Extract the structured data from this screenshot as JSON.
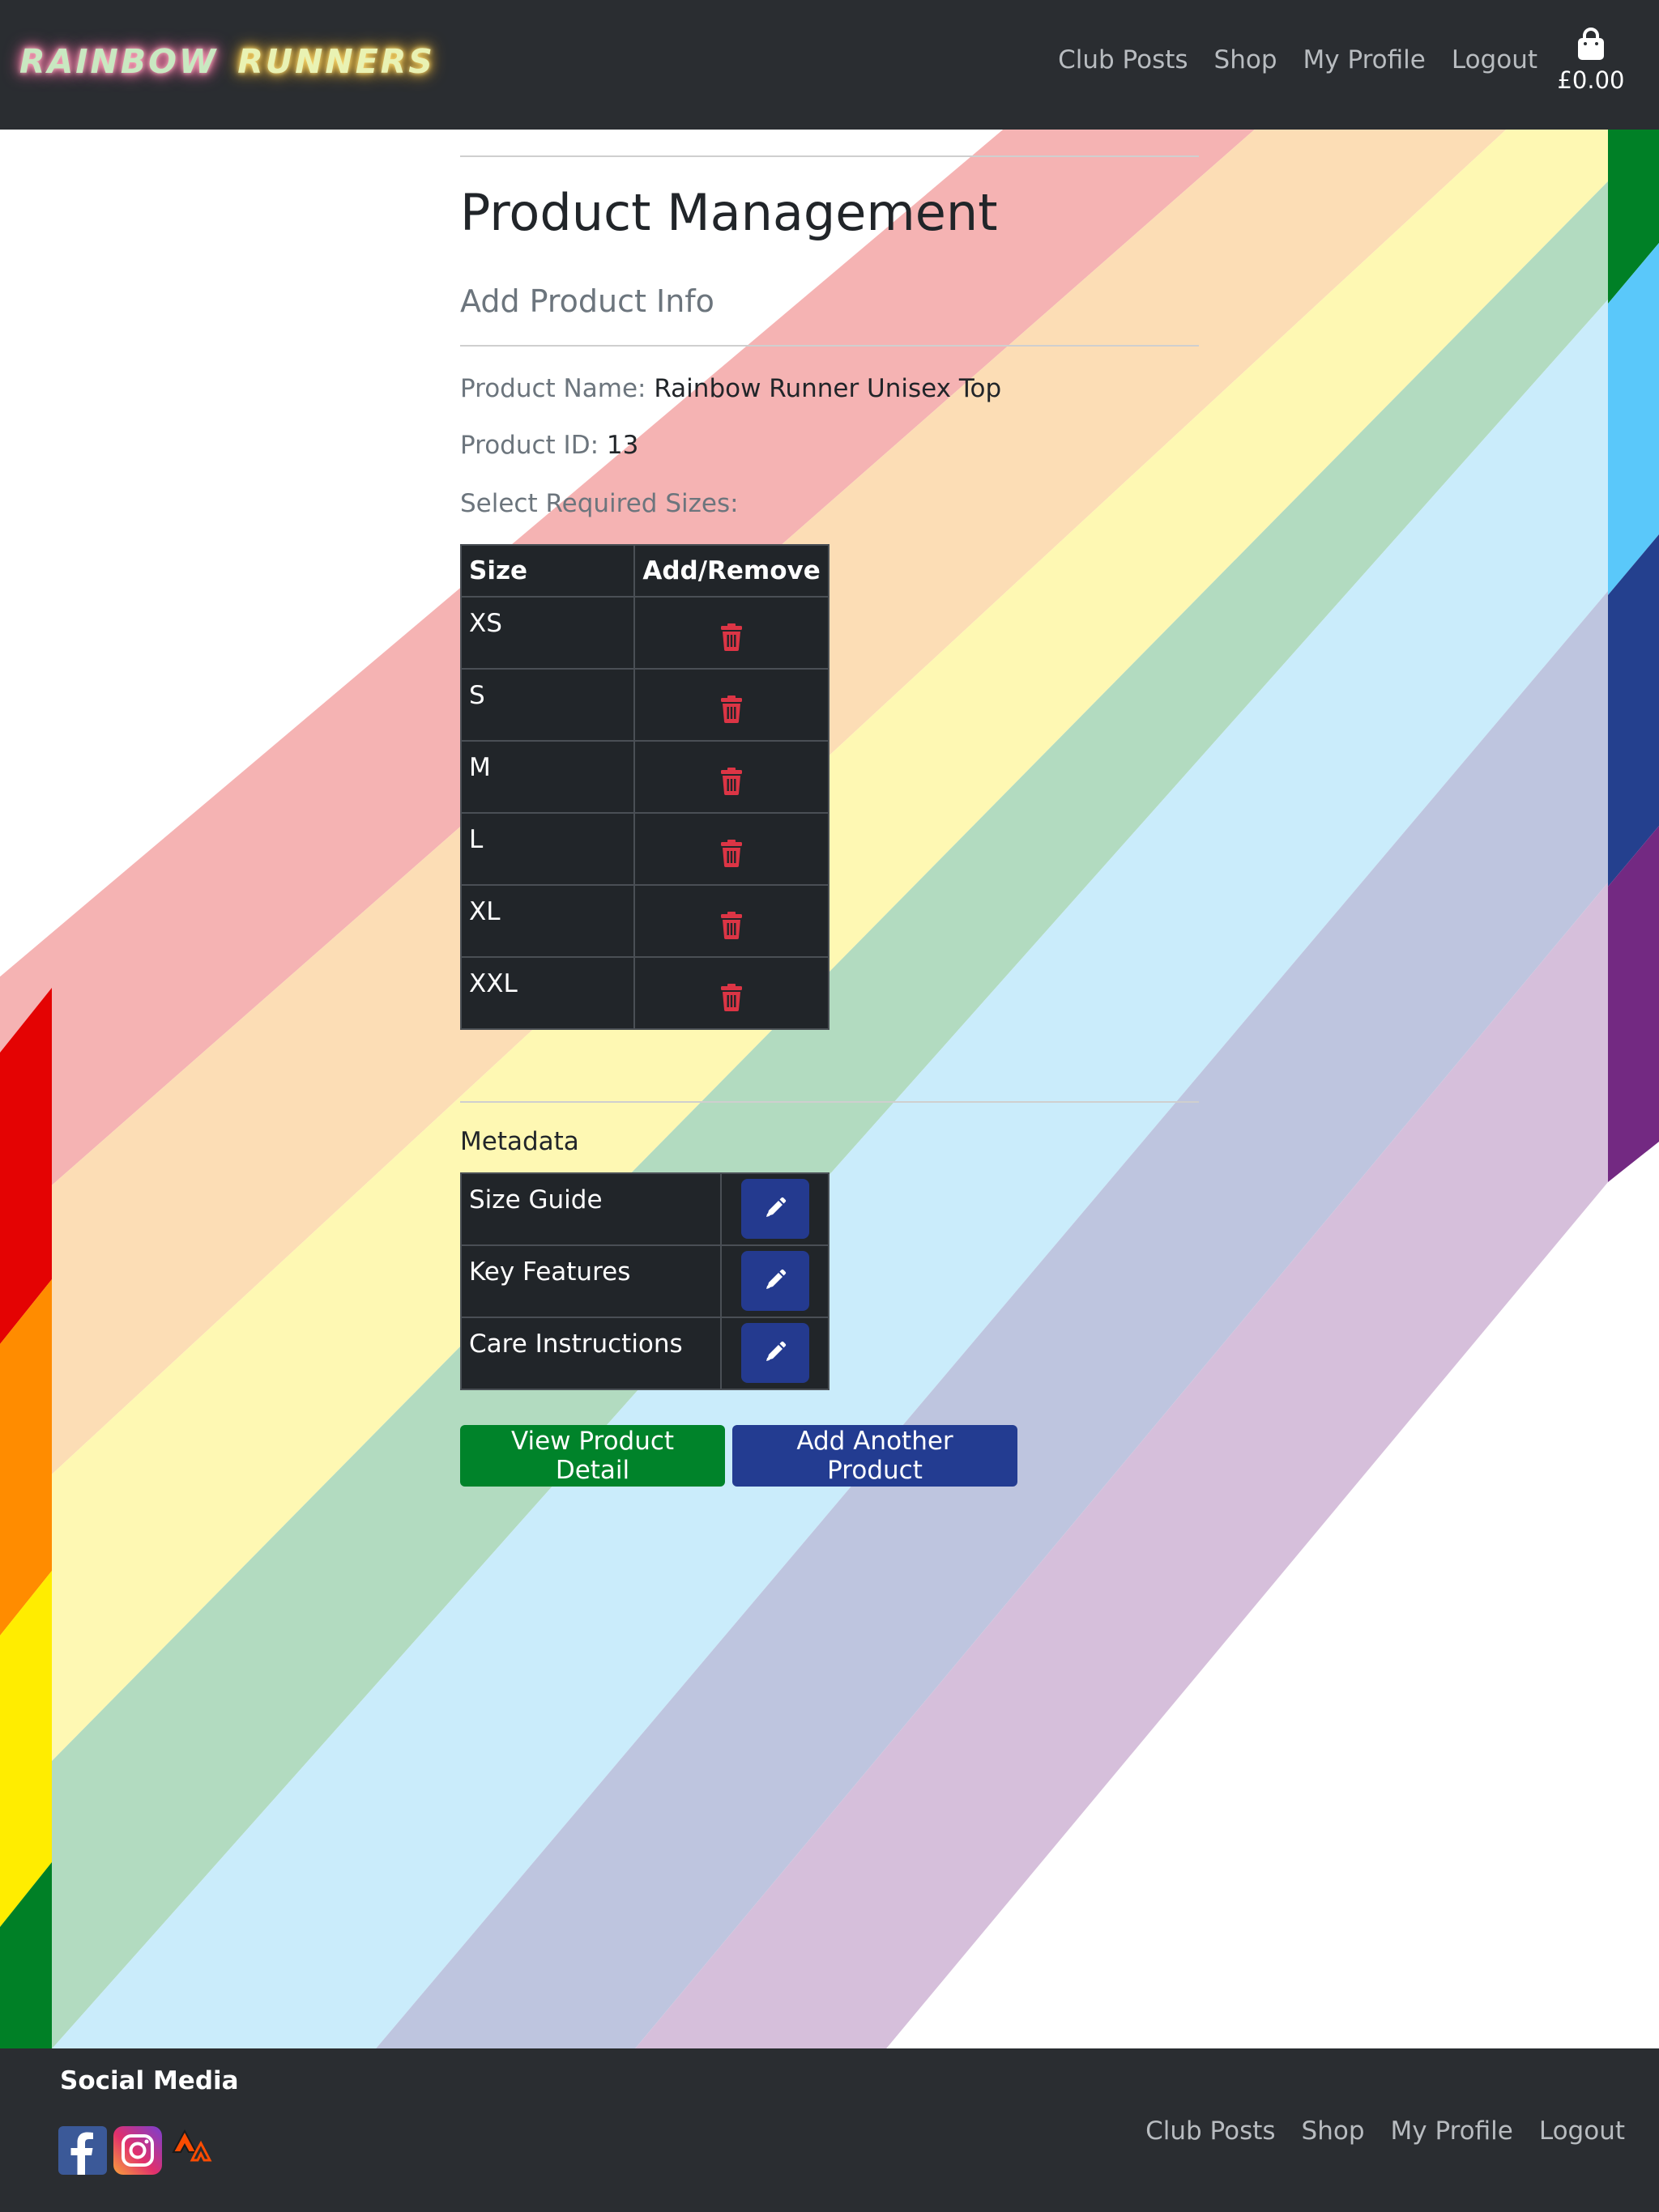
{
  "brand": {
    "word1": "RAINBOW",
    "word2": "RUNNERS"
  },
  "nav": {
    "links": [
      "Club Posts",
      "Shop",
      "My Profile",
      "Logout"
    ],
    "cart_total": "£0.00",
    "cart_icon": "shopping-bag-icon"
  },
  "main": {
    "page_title": "Product Management",
    "section_title": "Add Product Info",
    "product_name_label": "Product Name:",
    "product_name": "Rainbow Runner Unisex Top",
    "product_id_label": "Product ID:",
    "product_id": "13",
    "sizes_prompt": "Select Required Sizes:",
    "sizes_table": {
      "headers": [
        "Size",
        "Add/Remove"
      ],
      "rows": [
        "XS",
        "S",
        "M",
        "L",
        "XL",
        "XXL"
      ],
      "action_icon": "trash-icon",
      "action_color": "#dc3545"
    },
    "metadata_title": "Metadata",
    "metadata_rows": [
      "Size Guide",
      "Key Features",
      "Care Instructions"
    ],
    "metadata_action_icon": "pencil-icon",
    "buttons": {
      "view_detail": "View Product Detail",
      "add_another": "Add Another Product"
    }
  },
  "footer": {
    "social_title": "Social Media",
    "social_icons": [
      "facebook-icon",
      "instagram-icon",
      "strava-icon"
    ],
    "links": [
      "Club Posts",
      "Shop",
      "My Profile",
      "Logout"
    ]
  },
  "colors": {
    "navbar": "#2a2d31",
    "primary_blue": "#233c91",
    "success_green": "#00832a",
    "danger_red": "#dc3545",
    "rainbow": [
      "#e40303",
      "#ff8c00",
      "#ffed00",
      "#008026",
      "#5ac8fa",
      "#24408e",
      "#732982"
    ]
  }
}
